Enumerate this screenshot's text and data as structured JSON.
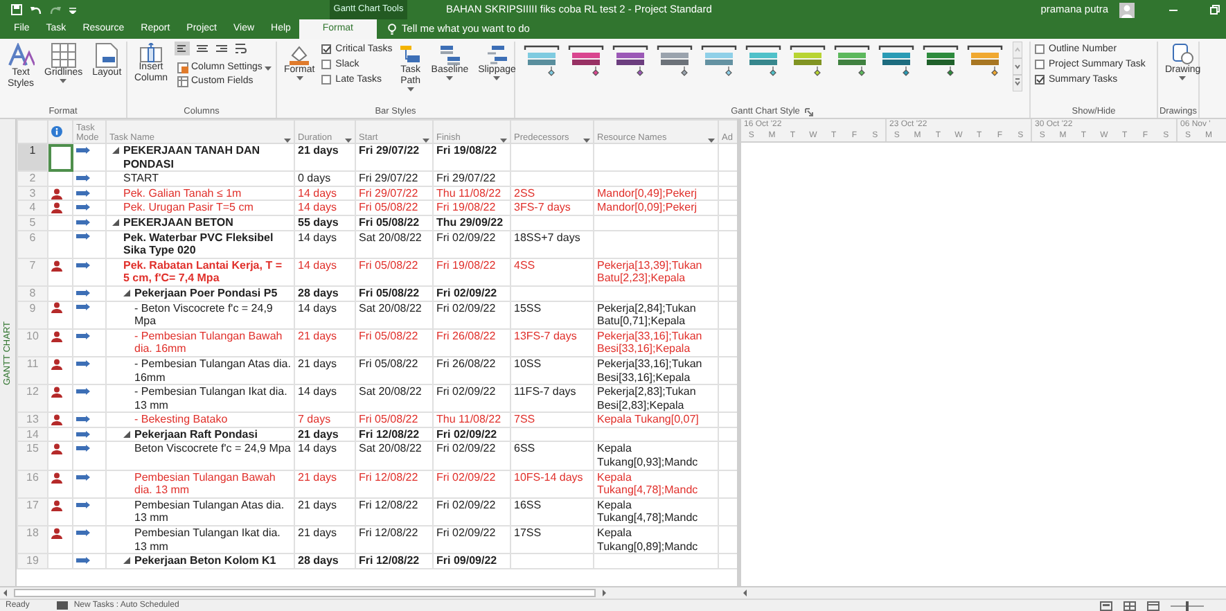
{
  "title_bar": {
    "context_label": "Gantt Chart Tools",
    "title": "BAHAN SKRIPSIIIII fiks coba RL test 2  -  Project Standard",
    "user": "pramana putra"
  },
  "ribbon_tabs": [
    {
      "label": "File",
      "selected": false
    },
    {
      "label": "Task",
      "selected": false
    },
    {
      "label": "Resource",
      "selected": false
    },
    {
      "label": "Report",
      "selected": false
    },
    {
      "label": "Project",
      "selected": false
    },
    {
      "label": "View",
      "selected": false
    },
    {
      "label": "Help",
      "selected": false
    },
    {
      "label": "Format",
      "selected": true
    }
  ],
  "tell_me": "Tell me what you want to do",
  "ribbon": {
    "format_group": {
      "label": "Format",
      "text_styles": "Text Styles",
      "gridlines": "Gridlines",
      "layout": "Layout"
    },
    "columns_group": {
      "label": "Columns",
      "insert_column": "Insert Column",
      "column_settings": "Column Settings",
      "custom_fields": "Custom Fields"
    },
    "bar_styles_group": {
      "label": "Bar Styles",
      "format": "Format",
      "checks": [
        {
          "label": "Critical Tasks",
          "checked": true
        },
        {
          "label": "Slack",
          "checked": false
        },
        {
          "label": "Late Tasks",
          "checked": false
        }
      ],
      "task_path": "Task Path",
      "baseline": "Baseline",
      "slippage": "Slippage"
    },
    "gantt_chart_style_group": {
      "label": "Gantt Chart Style",
      "styles": [
        {
          "color": "#7fcbe0"
        },
        {
          "color": "#d9468f"
        },
        {
          "color": "#9b59b6"
        },
        {
          "color": "#9aa3ad"
        },
        {
          "color": "#8fd0e8"
        },
        {
          "color": "#4fc1c9"
        },
        {
          "color": "#b8d432"
        },
        {
          "color": "#5cb85c"
        },
        {
          "color": "#2a9bb5"
        },
        {
          "color": "#2e8b3d"
        },
        {
          "color": "#f0a830"
        }
      ]
    },
    "show_hide_group": {
      "label": "Show/Hide",
      "checks": [
        {
          "label": "Outline Number",
          "checked": false
        },
        {
          "label": "Project Summary Task",
          "checked": false
        },
        {
          "label": "Summary Tasks",
          "checked": true
        }
      ]
    },
    "drawings_group": {
      "label": "Drawings",
      "drawing": "Drawing"
    }
  },
  "view_label": "GANTT CHART",
  "table": {
    "columns": [
      "Task Mode",
      "Task Name",
      "Duration",
      "Start",
      "Finish",
      "Predecessors",
      "Resource Names",
      "Ad"
    ],
    "tasks": [
      {
        "id": "1",
        "kind": "summary",
        "expanded": true,
        "selected": true,
        "critical": false,
        "bold": true,
        "resource_indicator": false,
        "name": "PEKERJAAN TANAH DAN PONDASI",
        "duration": "21 days",
        "start": "Fri 29/07/22",
        "finish": "Fri 19/08/22",
        "children": [
          {
            "id": "2",
            "kind": "task",
            "selected": false,
            "critical": false,
            "bold": false,
            "resource_indicator": false,
            "name": "START",
            "duration": "0 days",
            "start": "Fri 29/07/22",
            "finish": "Fri 29/07/22"
          },
          {
            "id": "3",
            "kind": "task",
            "selected": false,
            "critical": true,
            "bold": false,
            "resource_indicator": true,
            "name": "Pek. Galian Tanah ≤ 1m",
            "duration": "14 days",
            "start": "Fri 29/07/22",
            "finish": "Thu 11/08/22",
            "predecessors": "2SS",
            "resources": "Mandor[0,49];Pekerj"
          },
          {
            "id": "4",
            "kind": "task",
            "selected": false,
            "critical": true,
            "bold": false,
            "resource_indicator": true,
            "name": "Pek. Urugan Pasir T=5 cm",
            "duration": "14 days",
            "start": "Fri 05/08/22",
            "finish": "Fri 19/08/22",
            "predecessors": "3FS-7 days",
            "resources": "Mandor[0,09];Pekerj"
          }
        ]
      },
      {
        "id": "5",
        "kind": "summary",
        "expanded": true,
        "selected": false,
        "critical": false,
        "bold": true,
        "resource_indicator": false,
        "name": "PEKERJAAN BETON",
        "duration": "55 days",
        "start": "Fri 05/08/22",
        "finish": "Thu 29/09/22",
        "children": [
          {
            "id": "6",
            "kind": "task",
            "selected": false,
            "critical": false,
            "bold": true,
            "resource_indicator": false,
            "name": "Pek. Waterbar PVC Fleksibel Sika Type 020",
            "duration": "14 days",
            "start": "Sat 20/08/22",
            "finish": "Fri 02/09/22",
            "predecessors": "18SS+7 days"
          },
          {
            "id": "7",
            "kind": "task",
            "selected": false,
            "critical": true,
            "bold": true,
            "resource_indicator": true,
            "name": "Pek. Rabatan Lantai Kerja, T = 5 cm, f'C= 7,4 Mpa",
            "duration": "14 days",
            "start": "Fri 05/08/22",
            "finish": "Fri 19/08/22",
            "predecessors": "4SS",
            "resources": "Pekerja[13,39];Tukan Batu[2,23];Kepala"
          },
          {
            "id": "8",
            "kind": "summary",
            "expanded": true,
            "selected": false,
            "critical": false,
            "bold": true,
            "resource_indicator": false,
            "name": "Pekerjaan Poer Pondasi P5",
            "duration": "28 days",
            "start": "Fri 05/08/22",
            "finish": "Fri 02/09/22",
            "children": [
              {
                "id": "9",
                "kind": "task",
                "selected": false,
                "critical": false,
                "bold": false,
                "resource_indicator": true,
                "name": "- Beton Viscocrete f'c = 24,9 Mpa",
                "duration": "14 days",
                "start": "Sat 20/08/22",
                "finish": "Fri 02/09/22",
                "predecessors": "15SS",
                "resources": "Pekerja[2,84];Tukan Batu[0,71];Kepala"
              },
              {
                "id": "10",
                "kind": "task",
                "selected": false,
                "critical": true,
                "bold": false,
                "resource_indicator": true,
                "name": "- Pembesian Tulangan Bawah dia. 16mm",
                "duration": "21 days",
                "start": "Fri 05/08/22",
                "finish": "Fri 26/08/22",
                "predecessors": "13FS-7 days",
                "resources": "Pekerja[33,16];Tukan Besi[33,16];Kepala"
              },
              {
                "id": "11",
                "kind": "task",
                "selected": false,
                "critical": false,
                "bold": false,
                "resource_indicator": true,
                "name": "- Pembesian Tulangan Atas dia. 16mm",
                "duration": "21 days",
                "start": "Fri 05/08/22",
                "finish": "Fri 26/08/22",
                "predecessors": "10SS",
                "resources": "Pekerja[33,16];Tukan Besi[33,16];Kepala"
              },
              {
                "id": "12",
                "kind": "task",
                "selected": false,
                "critical": false,
                "bold": false,
                "resource_indicator": true,
                "name": "- Pembesian Tulangan Ikat dia. 13 mm",
                "duration": "14 days",
                "start": "Sat 20/08/22",
                "finish": "Fri 02/09/22",
                "predecessors": "11FS-7 days",
                "resources": "Pekerja[2,83];Tukan Besi[2,83];Kepala"
              },
              {
                "id": "13",
                "kind": "task",
                "selected": false,
                "critical": true,
                "bold": false,
                "resource_indicator": true,
                "name": "- Bekesting Batako",
                "duration": "7 days",
                "start": "Fri 05/08/22",
                "finish": "Thu 11/08/22",
                "predecessors": "7SS",
                "resources": "Kepala Tukang[0,07]"
              }
            ]
          },
          {
            "id": "14",
            "kind": "summary",
            "expanded": true,
            "selected": false,
            "critical": false,
            "bold": true,
            "resource_indicator": false,
            "name": "Pekerjaan Raft Pondasi",
            "duration": "21 days",
            "start": "Fri 12/08/22",
            "finish": "Fri 02/09/22",
            "children": [
              {
                "id": "15",
                "kind": "task",
                "selected": false,
                "critical": false,
                "bold": false,
                "resource_indicator": true,
                "name": "Beton Viscocrete f'c = 24,9 Mpa",
                "duration": "14 days",
                "start": "Sat 20/08/22",
                "finish": "Fri 02/09/22",
                "predecessors": "6SS",
                "resources": "Kepala Tukang[0,93];Mandc"
              },
              {
                "id": "16",
                "kind": "task",
                "selected": false,
                "critical": true,
                "bold": false,
                "resource_indicator": true,
                "name": "Pembesian Tulangan Bawah dia. 13 mm",
                "duration": "21 days",
                "start": "Fri 12/08/22",
                "finish": "Fri 02/09/22",
                "predecessors": "10FS-14 days",
                "resources": "Kepala Tukang[4,78];Mandc"
              },
              {
                "id": "17",
                "kind": "task",
                "selected": false,
                "critical": false,
                "bold": false,
                "resource_indicator": true,
                "name": "Pembesian Tulangan Atas dia. 13 mm",
                "duration": "21 days",
                "start": "Fri 12/08/22",
                "finish": "Fri 02/09/22",
                "predecessors": "16SS",
                "resources": "Kepala Tukang[4,78];Mandc"
              },
              {
                "id": "18",
                "kind": "task",
                "selected": false,
                "critical": false,
                "bold": false,
                "resource_indicator": true,
                "name": "Pembesian Tulangan Ikat dia. 13 mm",
                "duration": "21 days",
                "start": "Fri 12/08/22",
                "finish": "Fri 02/09/22",
                "predecessors": "17SS",
                "resources": "Kepala Tukang[0,89];Mandc"
              }
            ]
          },
          {
            "id": "19",
            "kind": "summary",
            "expanded": true,
            "selected": false,
            "critical": false,
            "bold": true,
            "resource_indicator": false,
            "name": "Pekerjaan Beton Kolom K1",
            "duration": "28 days",
            "start": "Fri 12/08/22",
            "finish": "Fri 09/09/22"
          }
        ]
      }
    ]
  },
  "timescale": [
    {
      "label": "16 Oct '22",
      "days": [
        "S",
        "M",
        "T",
        "W",
        "T",
        "F",
        "S"
      ]
    },
    {
      "label": "23 Oct '22",
      "days": [
        "S",
        "M",
        "T",
        "W",
        "T",
        "F",
        "S"
      ]
    },
    {
      "label": "30 Oct '22",
      "days": [
        "S",
        "M",
        "T",
        "W",
        "T",
        "F",
        "S"
      ]
    },
    {
      "label": "06 Nov '",
      "days": [
        "S",
        "M"
      ]
    }
  ],
  "status_bar": {
    "ready": "Ready",
    "new_tasks": "New Tasks : Auto Scheduled",
    "zoom_slider": {
      "level": 0.5
    }
  }
}
